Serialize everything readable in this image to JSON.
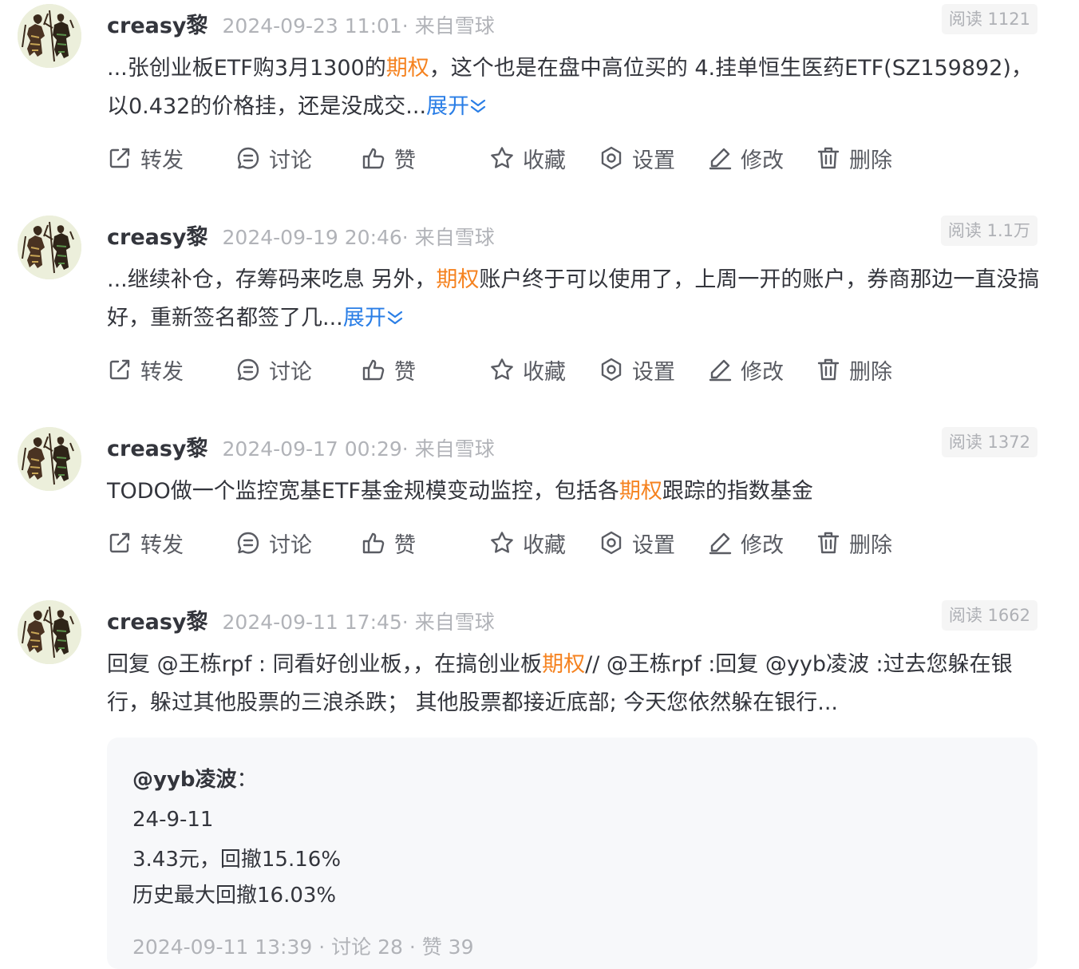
{
  "colors": {
    "highlight": "#f5821f",
    "link": "#2a7ee6",
    "meta": "#b1b3b8",
    "text": "#33353c"
  },
  "actions": {
    "forward": "转发",
    "discuss": "讨论",
    "like": "赞",
    "favorite": "收藏",
    "settings": "设置",
    "edit": "修改",
    "delete": "删除"
  },
  "posts": [
    {
      "username": "creasy黎",
      "meta": "2024-09-23 11:01· 来自雪球",
      "reads": "阅读 1121",
      "text_before": "...张创业板ETF购3月1300的",
      "highlight": "期权",
      "text_after": "，这个也是在盘中高位买的 4.挂单恒生医药ETF(SZ159892)，以0.432的价格挂，还是没成交...",
      "expand": "展开"
    },
    {
      "username": "creasy黎",
      "meta": "2024-09-19 20:46· 来自雪球",
      "reads": "阅读 1.1万",
      "text_before": "...继续补仓，存筹码来吃息 另外，",
      "highlight": "期权",
      "text_after": "账户终于可以使用了，上周一开的账户，券商那边一直没搞好，重新签名都签了几...",
      "expand": "展开"
    },
    {
      "username": "creasy黎",
      "meta": "2024-09-17 00:29· 来自雪球",
      "reads": "阅读 1372",
      "text_before": "TODO做一个监控宽基ETF基金规模变动监控，包括各",
      "highlight": "期权",
      "text_after": "跟踪的指数基金"
    },
    {
      "username": "creasy黎",
      "meta": "2024-09-11 17:45· 来自雪球",
      "reads": "阅读 1662",
      "text_before": "回复 @王栋rpf : 同看好创业板，，在搞创业板",
      "highlight": "期权",
      "text_after": "// @王栋rpf :回复 @yyb凌波 :过去您躲在银行，躲过其他股票的三浪杀跌； 其他股票都接近底部; 今天您依然躲在银行...",
      "quote": {
        "user": "@yyb凌波",
        "colon": "：",
        "lines": [
          "24-9-11",
          "3.43元，回撤15.16%",
          "历史最大回撤16.03%"
        ],
        "footer": "2024-09-11 13:39   · 讨论 28 · 赞 39"
      }
    }
  ]
}
